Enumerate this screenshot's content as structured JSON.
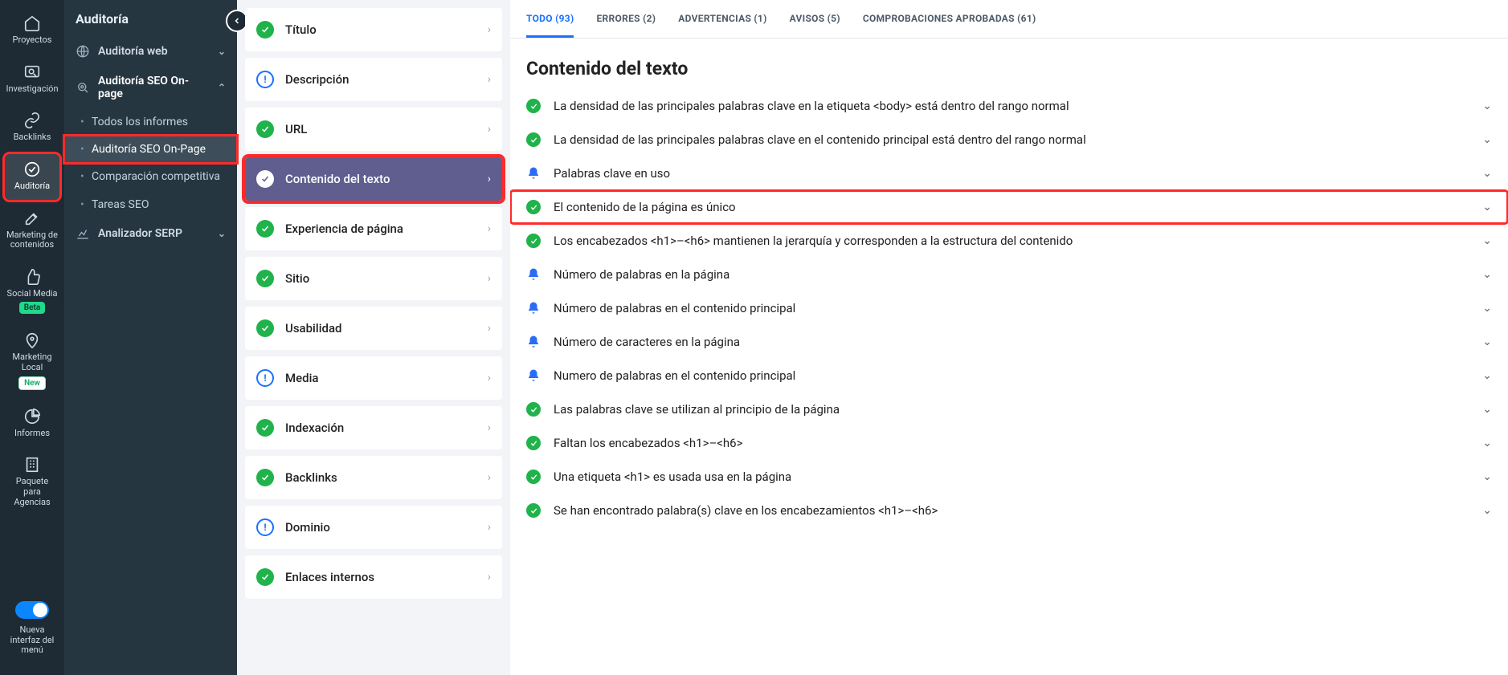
{
  "rail": {
    "items": [
      {
        "id": "proyectos",
        "label": "Proyectos"
      },
      {
        "id": "investigacion",
        "label": "Investigación"
      },
      {
        "id": "backlinks",
        "label": "Backlinks"
      },
      {
        "id": "auditoria",
        "label": "Auditoría",
        "active": true
      },
      {
        "id": "marketing-contenidos",
        "label": "Marketing de contenidos"
      },
      {
        "id": "social-media",
        "label": "Social Media",
        "badge": "Beta"
      },
      {
        "id": "marketing-local",
        "label": "Marketing Local",
        "badge": "New"
      },
      {
        "id": "informes",
        "label": "Informes"
      },
      {
        "id": "agencias",
        "label": "Paquete para Agencias"
      }
    ],
    "footer_label": "Nueva interfaz del menú"
  },
  "sidebar": {
    "title": "Auditoría",
    "groups": [
      {
        "id": "auditoria-web",
        "label": "Auditoría web",
        "expanded": false
      },
      {
        "id": "auditoria-seo-onpage",
        "label": "Auditoría SEO On-page",
        "expanded": true,
        "children": [
          {
            "id": "todos-los-informes",
            "label": "Todos los informes"
          },
          {
            "id": "auditoria-seo-on-page",
            "label": "Auditoría SEO On-Page",
            "active": true,
            "highlight": true
          },
          {
            "id": "comparacion-competitiva",
            "label": "Comparación competitiva"
          },
          {
            "id": "tareas-seo",
            "label": "Tareas SEO"
          }
        ]
      },
      {
        "id": "analizador-serp",
        "label": "Analizador SERP",
        "expanded": false
      }
    ]
  },
  "categories": [
    {
      "id": "titulo",
      "name": "Título",
      "status": "ok"
    },
    {
      "id": "descripcion",
      "name": "Descripción",
      "status": "info"
    },
    {
      "id": "url",
      "name": "URL",
      "status": "ok"
    },
    {
      "id": "contenido-del-texto",
      "name": "Contenido del texto",
      "status": "ok",
      "active": true,
      "highlight": true
    },
    {
      "id": "experiencia-de-pagina",
      "name": "Experiencia de página",
      "status": "ok"
    },
    {
      "id": "sitio",
      "name": "Sitio",
      "status": "ok"
    },
    {
      "id": "usabilidad",
      "name": "Usabilidad",
      "status": "ok"
    },
    {
      "id": "media",
      "name": "Media",
      "status": "info"
    },
    {
      "id": "indexacion",
      "name": "Indexación",
      "status": "ok"
    },
    {
      "id": "backlinks",
      "name": "Backlinks",
      "status": "ok"
    },
    {
      "id": "dominio",
      "name": "Dominio",
      "status": "info"
    },
    {
      "id": "enlaces-internos",
      "name": "Enlaces internos",
      "status": "ok"
    }
  ],
  "tabs": [
    {
      "id": "todo",
      "label": "TODO (93)",
      "active": true
    },
    {
      "id": "errores",
      "label": "ERRORES (2)"
    },
    {
      "id": "advertencias",
      "label": "ADVERTENCIAS (1)"
    },
    {
      "id": "avisos",
      "label": "AVISOS (5)"
    },
    {
      "id": "aprobadas",
      "label": "COMPROBACIONES APROBADAS (61)"
    }
  ],
  "main_title": "Contenido del texto",
  "checks": [
    {
      "status": "ok",
      "text": "La densidad de las principales palabras clave en la etiqueta <body> está dentro del rango normal"
    },
    {
      "status": "ok",
      "text": "La densidad de las principales palabras clave en el contenido principal está dentro del rango normal"
    },
    {
      "status": "bell",
      "text": "Palabras clave en uso"
    },
    {
      "status": "ok",
      "text": "El contenido de la página es único",
      "highlight": true
    },
    {
      "status": "ok",
      "text": "Los encabezados <h1>–<h6> mantienen la jerarquía y corresponden a la estructura del contenido"
    },
    {
      "status": "bell",
      "text": "Número de palabras en la página"
    },
    {
      "status": "bell",
      "text": "Número de palabras en el contenido principal"
    },
    {
      "status": "bell",
      "text": "Número de caracteres en la página"
    },
    {
      "status": "bell",
      "text": "Numero de palabras en el contenido principal"
    },
    {
      "status": "ok",
      "text": "Las palabras clave se utilizan al principio de la página"
    },
    {
      "status": "ok",
      "text": "Faltan los encabezados <h1>–<h6>"
    },
    {
      "status": "ok",
      "text": "Una etiqueta <h1> es usada usa en la página"
    },
    {
      "status": "ok",
      "text": "Se han encontrado palabra(s) clave en los encabezamientos <h1>–<h6>"
    }
  ]
}
